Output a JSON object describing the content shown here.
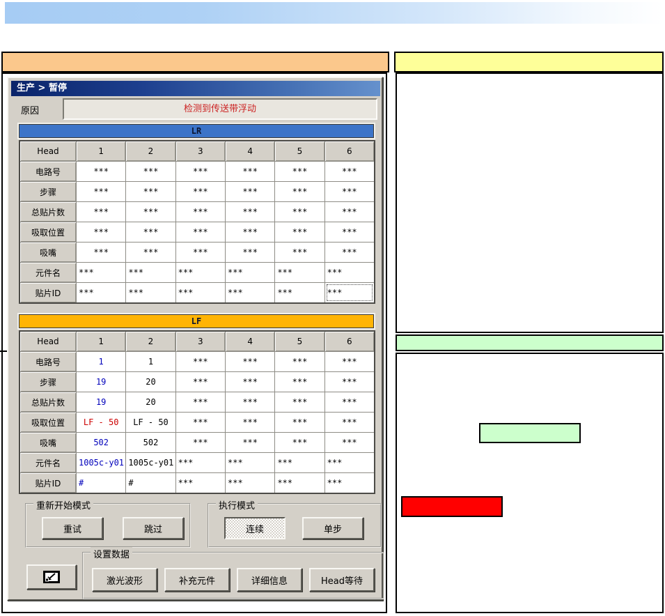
{
  "dialog": {
    "title": "生产 > 暂停",
    "reason": {
      "label": "原因",
      "value": "检测到传送带浮动"
    }
  },
  "tables": {
    "head_label": "Head",
    "columns": [
      "1",
      "2",
      "3",
      "4",
      "5",
      "6"
    ],
    "sections": [
      {
        "id": "lr",
        "title": "LR",
        "rows": [
          {
            "label": "电路号",
            "values": [
              "***",
              "***",
              "***",
              "***",
              "***",
              "***"
            ]
          },
          {
            "label": "步骤",
            "values": [
              "***",
              "***",
              "***",
              "***",
              "***",
              "***"
            ]
          },
          {
            "label": "总贴片数",
            "values": [
              "***",
              "***",
              "***",
              "***",
              "***",
              "***"
            ]
          },
          {
            "label": "吸取位置",
            "values": [
              "***",
              "***",
              "***",
              "***",
              "***",
              "***"
            ]
          },
          {
            "label": "吸嘴",
            "values": [
              "***",
              "***",
              "***",
              "***",
              "***",
              "***"
            ]
          },
          {
            "label": "元件名",
            "values": [
              "***",
              "***",
              "***",
              "***",
              "***",
              "***"
            ],
            "align": "left"
          },
          {
            "label": "贴片ID",
            "values": [
              "***",
              "***",
              "***",
              "***",
              "***",
              "***"
            ],
            "align": "left",
            "focus_col": 5
          }
        ]
      },
      {
        "id": "lf",
        "title": "LF",
        "rows": [
          {
            "label": "电路号",
            "values": [
              "1",
              "1",
              "***",
              "***",
              "***",
              "***"
            ],
            "colors": [
              "blue",
              "black",
              "black",
              "black",
              "black",
              "black"
            ]
          },
          {
            "label": "步骤",
            "values": [
              "19",
              "20",
              "***",
              "***",
              "***",
              "***"
            ],
            "colors": [
              "blue",
              "black",
              "black",
              "black",
              "black",
              "black"
            ]
          },
          {
            "label": "总贴片数",
            "values": [
              "19",
              "20",
              "***",
              "***",
              "***",
              "***"
            ],
            "colors": [
              "blue",
              "black",
              "black",
              "black",
              "black",
              "black"
            ]
          },
          {
            "label": "吸取位置",
            "values": [
              "LF - 50",
              "LF - 50",
              "***",
              "***",
              "***",
              "***"
            ],
            "colors": [
              "red",
              "black",
              "black",
              "black",
              "black",
              "black"
            ]
          },
          {
            "label": "吸嘴",
            "values": [
              "502",
              "502",
              "***",
              "***",
              "***",
              "***"
            ],
            "colors": [
              "blue",
              "black",
              "black",
              "black",
              "black",
              "black"
            ]
          },
          {
            "label": "元件名",
            "values": [
              "1005c-y01",
              "1005c-y01",
              "***",
              "***",
              "***",
              "***"
            ],
            "colors": [
              "blue",
              "black",
              "black",
              "black",
              "black",
              "black"
            ],
            "align": "left"
          },
          {
            "label": "贴片ID",
            "values": [
              "#",
              "#",
              "***",
              "***",
              "***",
              "***"
            ],
            "colors": [
              "blue",
              "black",
              "black",
              "black",
              "black",
              "black"
            ],
            "align": "left"
          }
        ]
      }
    ]
  },
  "controls": {
    "restart_group": {
      "label": "重新开始模式",
      "buttons": [
        {
          "label": "重试"
        },
        {
          "label": "跳过"
        }
      ]
    },
    "exec_group": {
      "label": "执行模式",
      "buttons": [
        {
          "label": "连续",
          "pressed": true
        },
        {
          "label": "单步"
        }
      ]
    },
    "settings_group": {
      "label": "设置数据",
      "buttons": [
        {
          "label": "激光波形"
        },
        {
          "label": "补充元件"
        },
        {
          "label": "详细信息"
        },
        {
          "label": "Head等待"
        }
      ]
    }
  },
  "colors": {
    "lr_bar": "#3c74c8",
    "lf_bar": "#ffb404",
    "header_orange": "#fbc88c",
    "header_yellow": "#feff99",
    "status_green": "#ccffcc",
    "alert_red": "#ff0000",
    "reason_text": "#cc2222",
    "value_blue": "#0000bb",
    "value_red": "#cc0000"
  }
}
